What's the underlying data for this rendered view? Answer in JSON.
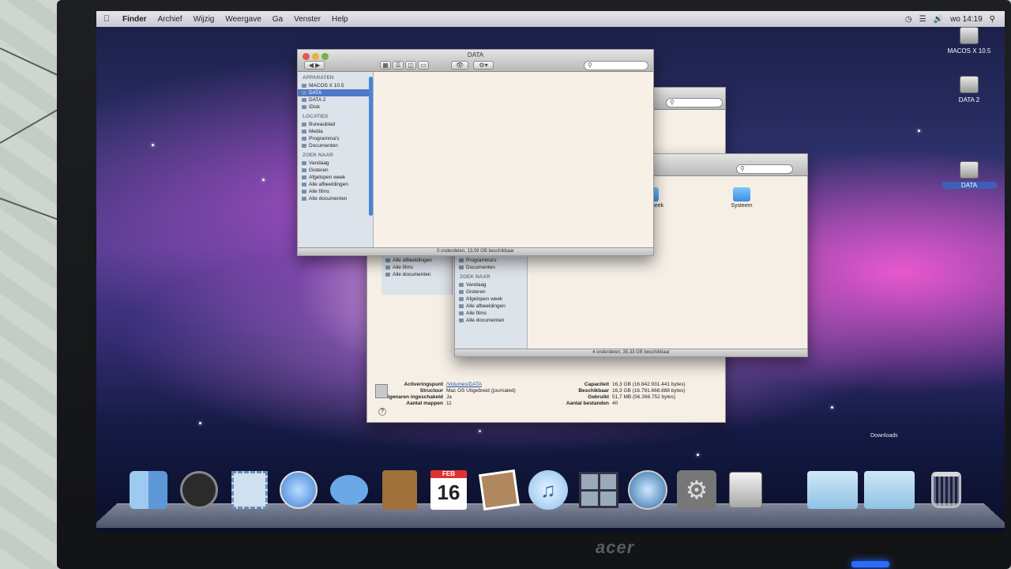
{
  "menubar": {
    "apple_icon": "apple-icon",
    "items": [
      "Finder",
      "Archief",
      "Wijzig",
      "Weergave",
      "Ga",
      "Venster",
      "Help"
    ],
    "time": "wo 14:19"
  },
  "desktop": {
    "icons": [
      {
        "label": "MACOS X 10.5",
        "selected": false
      },
      {
        "label": "DATA 2",
        "selected": false
      },
      {
        "label": "DATA",
        "selected": true
      }
    ]
  },
  "windows": {
    "front": {
      "title": "DATA",
      "sidebar_sections": [
        {
          "header": "APPARATEN",
          "items": [
            "MACOS X 10.5",
            "DATA",
            "DATA 2",
            "iDisk"
          ]
        },
        {
          "header": "LOCATIES",
          "items": [
            "Bureaublad",
            "Media",
            "Programma's",
            "Documenten"
          ]
        },
        {
          "header": "ZOEK NAAR",
          "items": [
            "Vandaag",
            "Gisteren",
            "Afgelopen week",
            "Alle afbeeldingen",
            "Alle films",
            "Alle documenten"
          ]
        }
      ],
      "selected_item": "DATA",
      "status": "0 onderdelen, 13,09 GB beschikbaar"
    },
    "middle": {
      "folders": [
        "Bibliotheek",
        "Systeem"
      ],
      "sidebar_items": [
        "Programma's",
        "Documenten"
      ],
      "search_section": {
        "header": "ZOEK NAAR",
        "items": [
          "Vandaag",
          "Gisteren",
          "Afgelopen week",
          "Alle afbeeldingen",
          "Alle films",
          "Alle documenten"
        ]
      },
      "status": "4 onderdelen, 35,33 GB beschikbaar"
    },
    "back": {
      "sidebar_items": [
        "Alle afbeeldingen",
        "Alle films",
        "Alle documenten"
      ],
      "info_left": [
        {
          "k": "Activeringspunt",
          "v": "/Volumes/DATA"
        },
        {
          "k": "Structuur",
          "v": "Mac OS Uitgebreid (journaled)"
        },
        {
          "k": "Eigenaren ingeschakeld",
          "v": "Ja"
        },
        {
          "k": "Aantal mappen",
          "v": "11"
        }
      ],
      "info_right": [
        {
          "k": "Capaciteit",
          "v": "16,3 GB (16.842.931.441 bytes)"
        },
        {
          "k": "Beschikbaar",
          "v": "16,3 GB (16.791.668.888 bytes)"
        },
        {
          "k": "Gebruikt",
          "v": "51,7 MB (56.266.752 bytes)"
        },
        {
          "k": "Aantal bestanden",
          "v": "40"
        }
      ]
    }
  },
  "dock": {
    "stack_label": "Downloads",
    "items": [
      {
        "name": "Finder",
        "icon": "finder-icon",
        "color": "#6aa8e8"
      },
      {
        "name": "Dashboard",
        "icon": "dashboard-icon",
        "color": "#333333"
      },
      {
        "name": "Mail",
        "icon": "mail-icon",
        "color": "#8ab0d8"
      },
      {
        "name": "Safari",
        "icon": "safari-icon",
        "color": "#3f7fd6"
      },
      {
        "name": "iChat",
        "icon": "ichat-icon",
        "color": "#5a9ae0"
      },
      {
        "name": "Adresboek",
        "icon": "address-book-icon",
        "color": "#a0703a"
      },
      {
        "name": "iCal",
        "icon": "ical-icon",
        "color": "#e8e8e8"
      },
      {
        "name": "Photo Booth",
        "icon": "photo-icon",
        "color": "#b08860"
      },
      {
        "name": "iTunes",
        "icon": "itunes-icon",
        "color": "#4fa0e0"
      },
      {
        "name": "Spaces",
        "icon": "spaces-icon",
        "color": "#5a6a88"
      },
      {
        "name": "Time Machine",
        "icon": "time-machine-icon",
        "color": "#2e6ea8"
      },
      {
        "name": "Systeemvoorkeuren",
        "icon": "system-preferences-icon",
        "color": "#8a8a8a"
      },
      {
        "name": "Schijfhulpprogramma",
        "icon": "disk-utility-icon",
        "color": "#c8c8c8"
      }
    ],
    "cal_day": "16",
    "cal_month": "FEB"
  },
  "monitor": {
    "brand": "acer"
  }
}
